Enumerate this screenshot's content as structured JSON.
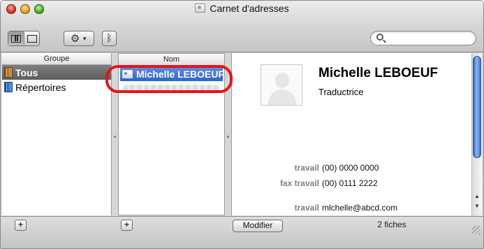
{
  "window": {
    "title": "Carnet d'adresses"
  },
  "toolbar": {
    "view_buttons": [
      "columns-view",
      "card-view"
    ],
    "action_icon": "gear-icon",
    "bluetooth_icon": "bluetooth-icon",
    "search_value": ""
  },
  "groups": {
    "header": "Groupe",
    "items": [
      {
        "label": "Tous",
        "icon": "book-icon",
        "selected": true
      },
      {
        "label": "Répertoires",
        "icon": "book-icon",
        "selected": false
      }
    ]
  },
  "names": {
    "header": "Nom",
    "items": [
      {
        "label": "Michelle LEBOEUF",
        "selected": true
      }
    ]
  },
  "card": {
    "name": "Michelle LEBOEUF",
    "job_title": "Traductrice",
    "fields": [
      {
        "label": "travail",
        "value": "(00) 0000 0000"
      },
      {
        "label": "fax travail",
        "value": "(00) 0111 2222"
      },
      {
        "label": "travail",
        "value": "mlchelle@abcd.com"
      }
    ]
  },
  "bottombar": {
    "add_group_label": "+",
    "add_name_label": "+",
    "edit_label": "Modifier",
    "status": "2 fiches"
  },
  "colors": {
    "selection_blue": "#2d63c6",
    "selection_gray": "#5d5d5d",
    "highlight_ring": "#e3141d"
  }
}
